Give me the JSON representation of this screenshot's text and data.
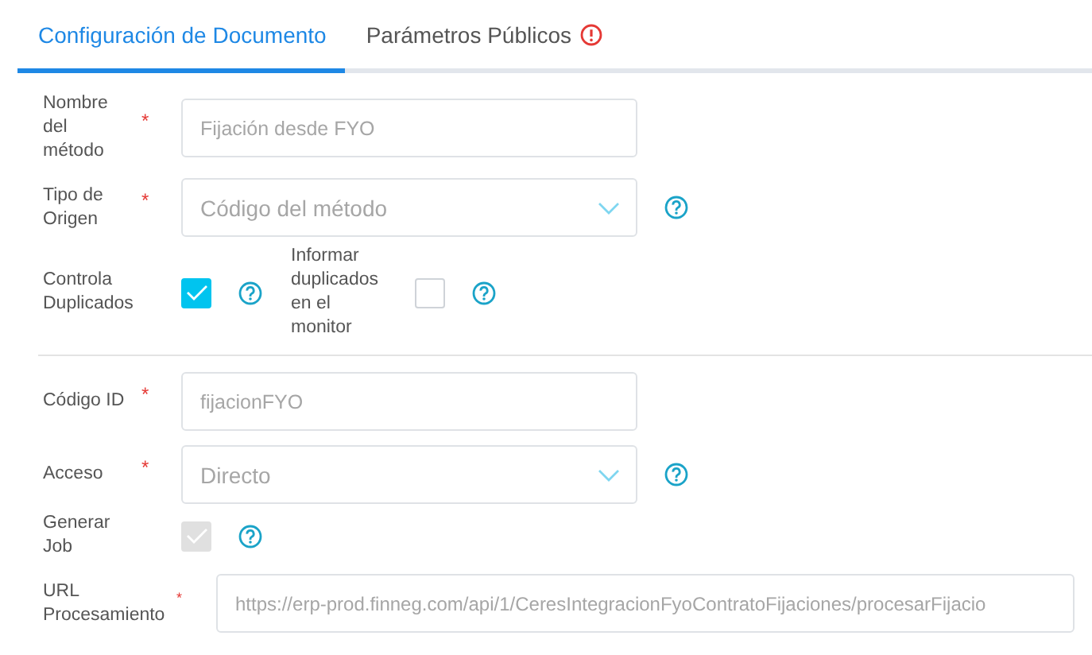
{
  "tabs": [
    {
      "label": "Configuración de Documento",
      "selected": true,
      "alert": false
    },
    {
      "label": "Parámetros Públicos",
      "selected": false,
      "alert": true
    }
  ],
  "rows": [
    {
      "kind": "text",
      "label": "Nombre\ndel\nmétodo",
      "required": "*",
      "value": "Fijación desde FYO",
      "wide": false
    },
    {
      "kind": "select",
      "label": "Tipo de\nOrigen",
      "required": "*",
      "value": "Código del método",
      "help": true
    },
    {
      "kind": "checkboxes",
      "items": [
        {
          "label": "Controla\nDuplicados",
          "checked": true,
          "disabled": false,
          "help": true
        },
        {
          "label": "Informar\nduplicados\nen el\nmonitor",
          "checked": false,
          "disabled": false,
          "help": true
        }
      ]
    },
    {
      "kind": "divider"
    },
    {
      "kind": "text",
      "label": "Código ID",
      "required": "*",
      "value": "fijacionFYO",
      "wide": false
    },
    {
      "kind": "select",
      "label": "Acceso",
      "required": "*",
      "value": "Directo",
      "help": true
    },
    {
      "kind": "checkboxes",
      "items": [
        {
          "label": "Generar Job",
          "checked": true,
          "disabled": true,
          "help": true
        }
      ]
    },
    {
      "kind": "text",
      "label": "URL\nProcesamiento",
      "required": "*",
      "value": "https://erp-prod.finneg.com/api/1/CeresIntegracionFyoContratoFijaciones/procesarFijacio",
      "wide": true
    }
  ]
}
